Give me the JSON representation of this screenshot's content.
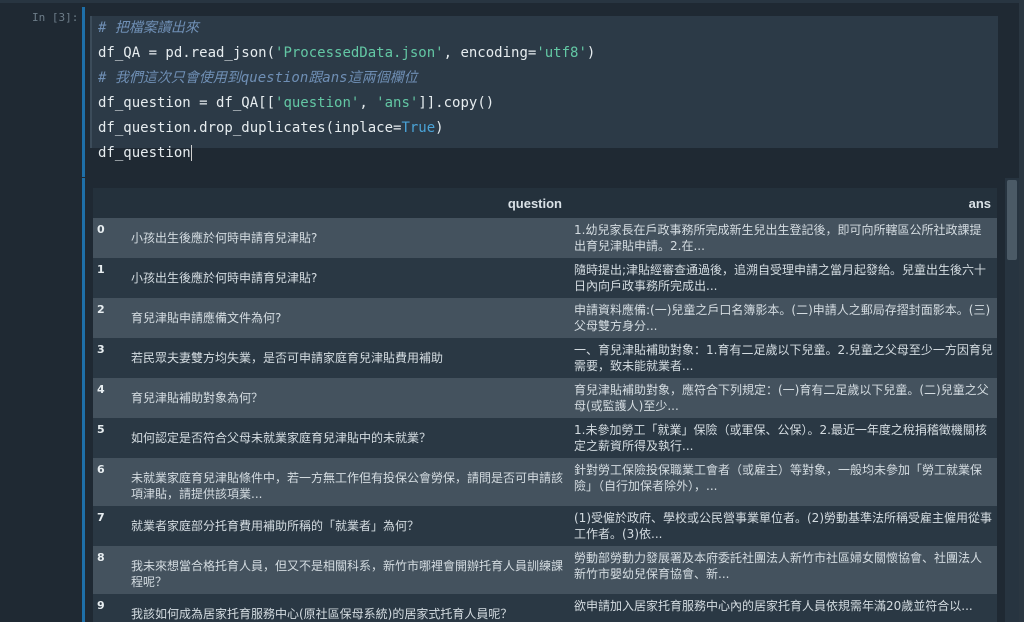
{
  "input_cell": {
    "prompt": "In [3]:",
    "lines": [
      {
        "comment": "# 把檔案讀出來"
      },
      {
        "a": "df_QA = pd.read_json(",
        "s1": "'ProcessedData.json'",
        "b": ", encoding=",
        "s2": "'utf8'",
        "c": ")"
      },
      {
        "comment": "# 我們這次只會使用到question跟ans這兩個欄位"
      },
      {
        "a": "df_question = df_QA[[",
        "s1": "'question'",
        "b": ", ",
        "s2": "'ans'",
        "c": "]].copy()"
      },
      {
        "a": "df_question.drop_duplicates(inplace=",
        "kw": "True",
        "c": ")"
      },
      {
        "a": "df_question"
      }
    ]
  },
  "output_table": {
    "columns": {
      "question": "question",
      "ans": "ans"
    },
    "rows": [
      {
        "idx": "0",
        "question": "小孩出生後應於何時申請育兒津貼?",
        "ans": "1.幼兒家長在戶政事務所完成新生兒出生登記後，即可向所轄區公所社政課提出育兒津貼申請。2.在..."
      },
      {
        "idx": "1",
        "question": "小孩出生後應於何時申請育兒津貼?",
        "ans": "隨時提出;津貼經審查通過後，追溯自受理申請之當月起發給。兒童出生後六十日內向戶政事務所完成出..."
      },
      {
        "idx": "2",
        "question": "育兒津貼申請應備文件為何?",
        "ans": "申請資料應備:(一)兒童之戶口名簿影本。(二)申請人之郵局存摺封面影本。(三)父母雙方身分..."
      },
      {
        "idx": "3",
        "question": "若民眾夫妻雙方均失業，是否可申請家庭育兒津貼費用補助",
        "ans": "一、育兒津貼補助對象：1.育有二足歲以下兒童。2.兒童之父母至少一方因育兒需要，致未能就業者..."
      },
      {
        "idx": "4",
        "question": "育兒津貼補助對象為何？",
        "ans": "育兒津貼補助對象，應符合下列規定：(一)育有二足歲以下兒童。(二)兒童之父母(或監護人)至少..."
      },
      {
        "idx": "5",
        "question": "如何認定是否符合父母未就業家庭育兒津貼中的未就業？",
        "ans": "1.未參加勞工「就業」保險（或軍保、公保）。2.最近一年度之稅捐稽徵機關核定之薪資所得及執行..."
      },
      {
        "idx": "6",
        "question": "未就業家庭育兒津貼條件中，若一方無工作但有投保公會勞保，請問是否可申請該項津貼，請提供該項業...",
        "ans": "針對勞工保險投保職業工會者（或雇主）等對象，一般均未參加「勞工就業保險」（自行加保者除外），..."
      },
      {
        "idx": "7",
        "question": "就業者家庭部分托育費用補助所稱的「就業者」為何？",
        "ans": "(1)受僱於政府、學校或公民營事業單位者。(2)勞動基準法所稱受雇主僱用從事工作者。(3)依..."
      },
      {
        "idx": "8",
        "question": "我未來想當合格托育人員，但又不是相關科系，新竹市哪裡會開辦托育人員訓練課程呢？",
        "ans": "勞動部勞動力發展署及本府委託社團法人新竹市社區婦女關懷協會、社團法人新竹市嬰幼兒保育協會、新..."
      },
      {
        "idx": "9",
        "question": "我該如何成為居家托育服務中心(原社區保母系統)的居家式托育人員呢？",
        "ans": "欲申請加入居家托育服務中心內的居家托育人員依規需年滿20歲並符合以..."
      }
    ]
  }
}
